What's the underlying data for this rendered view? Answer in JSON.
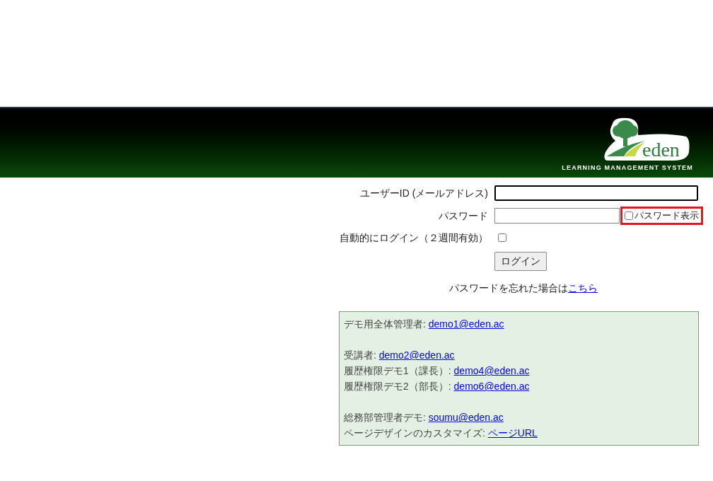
{
  "banner": {
    "logo_text": "eden",
    "tagline": "LEARNING MANAGEMENT SYSTEM"
  },
  "login_form": {
    "user_id": {
      "label": "ユーザーID (メールアドレス)",
      "focused": true
    },
    "password": {
      "label": "パスワード",
      "focused": false
    },
    "show_password": {
      "label": "パスワード表示",
      "checked": false,
      "highlighted": true
    },
    "auto_login": {
      "label": "自動的にログイン（２週間有効）",
      "checked": false
    },
    "login_button": "ログイン",
    "forgot": {
      "text": "パスワードを忘れた場合は",
      "link": "こちら"
    }
  },
  "demo_accounts": [
    [
      {
        "label": "デモ用全体管理者: ",
        "link": "demo1@eden.ac"
      }
    ],
    [
      {
        "label": "受講者: ",
        "link": "demo2@eden.ac"
      },
      {
        "label": "履歴権限デモ1（課長）: ",
        "link": "demo4@eden.ac"
      },
      {
        "label": "履歴権限デモ2（部長）: ",
        "link": "demo6@eden.ac"
      }
    ],
    [
      {
        "label": "総務部管理者デモ: ",
        "link": "soumu@eden.ac"
      },
      {
        "label": "ページデザインのカスタマイズ: ",
        "link": "ページURL"
      }
    ]
  ]
}
